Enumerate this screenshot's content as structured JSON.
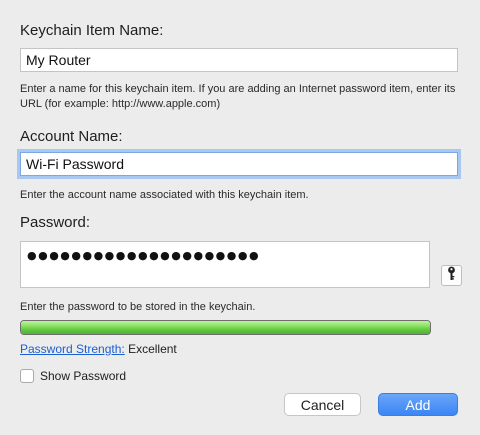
{
  "item_name": {
    "label": "Keychain Item Name:",
    "value": "My Router",
    "help": "Enter a name for this keychain item. If you are adding an Internet password item, enter its URL (for example: http://www.apple.com)"
  },
  "account_name": {
    "label": "Account Name:",
    "value": "Wi-Fi Password",
    "help": "Enter the account name associated with this keychain item."
  },
  "password": {
    "label": "Password:",
    "masked_value": "●●●●●●●●●●●●●●●●●●●●●",
    "help": "Enter the password to be stored in the keychain.",
    "key_icon": "key-icon"
  },
  "strength": {
    "link_label": "Password Strength:",
    "value_label": "Excellent",
    "fill_fraction": 1.0,
    "fill_color": "#5ec63e"
  },
  "show_password": {
    "label": "Show Password",
    "checked": false
  },
  "buttons": {
    "cancel_label": "Cancel",
    "add_label": "Add"
  },
  "colors": {
    "background": "#ececec",
    "accent": "#3b85f5",
    "focus_ring": "#a9c8f1",
    "link": "#1c5fd1"
  }
}
